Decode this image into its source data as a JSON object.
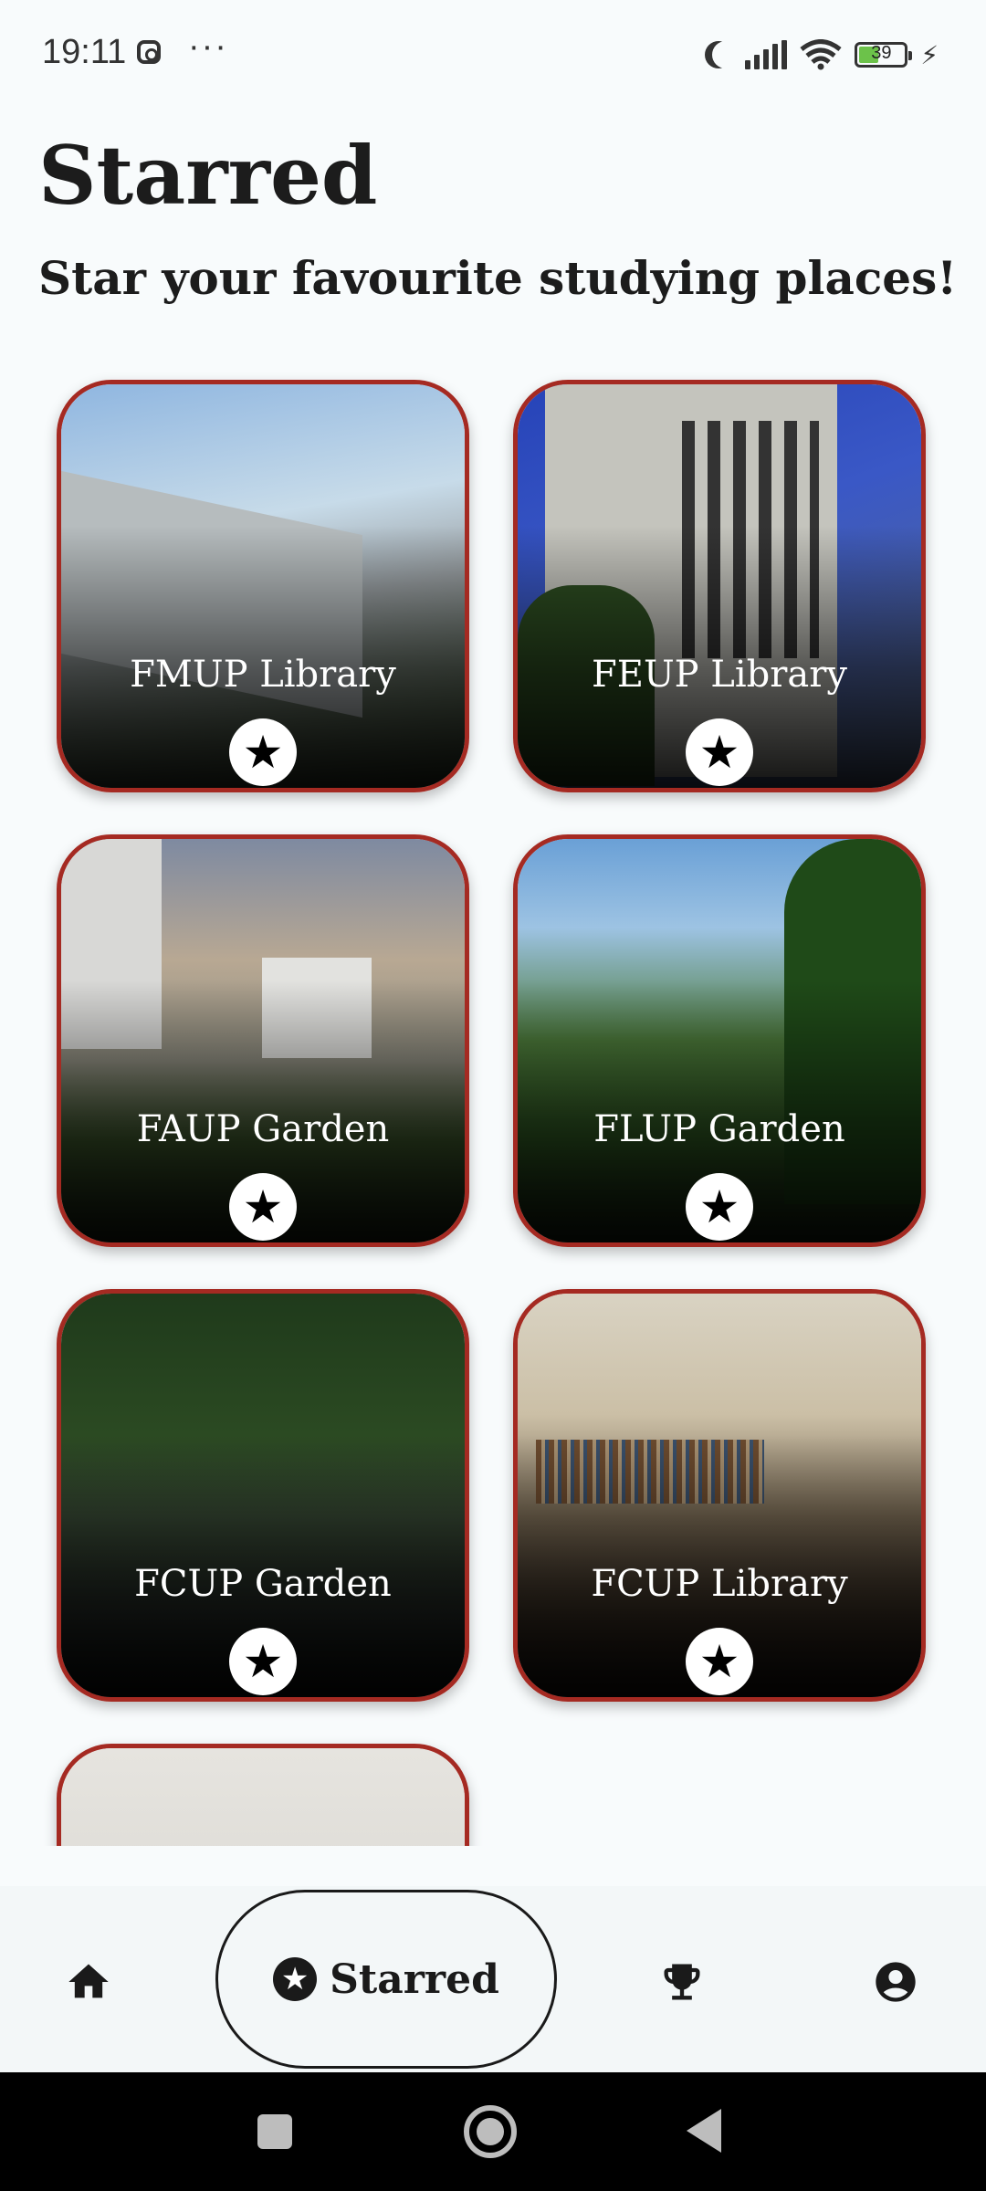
{
  "status_bar": {
    "time": "19:11",
    "more": "···",
    "battery_level": "39",
    "icons": [
      "instagram-icon",
      "moon-icon",
      "signal-icon",
      "wifi-icon",
      "battery-icon",
      "charging-icon"
    ]
  },
  "header": {
    "title": "Starred",
    "subtitle": "Star your favourite studying places!"
  },
  "places": [
    {
      "name": "FMUP Library",
      "starred": true
    },
    {
      "name": "FEUP Library",
      "starred": true
    },
    {
      "name": "FAUP Garden",
      "starred": true
    },
    {
      "name": "FLUP Garden",
      "starred": true
    },
    {
      "name": "FCUP Garden",
      "starred": true
    },
    {
      "name": "FCUP Library",
      "starred": true
    },
    {
      "name": "",
      "starred": true
    }
  ],
  "colors": {
    "card_border": "#a52a22",
    "background": "#f8fbfc",
    "star_button": "#ffffff"
  },
  "nav": {
    "items": [
      {
        "icon": "home-icon",
        "label": "",
        "active": false
      },
      {
        "icon": "star-icon",
        "label": "Starred",
        "active": true
      },
      {
        "icon": "trophy-icon",
        "label": "",
        "active": false
      },
      {
        "icon": "profile-icon",
        "label": "",
        "active": false
      }
    ],
    "active_label": "Starred"
  },
  "system_nav": [
    "recents-button",
    "home-button",
    "back-button"
  ]
}
